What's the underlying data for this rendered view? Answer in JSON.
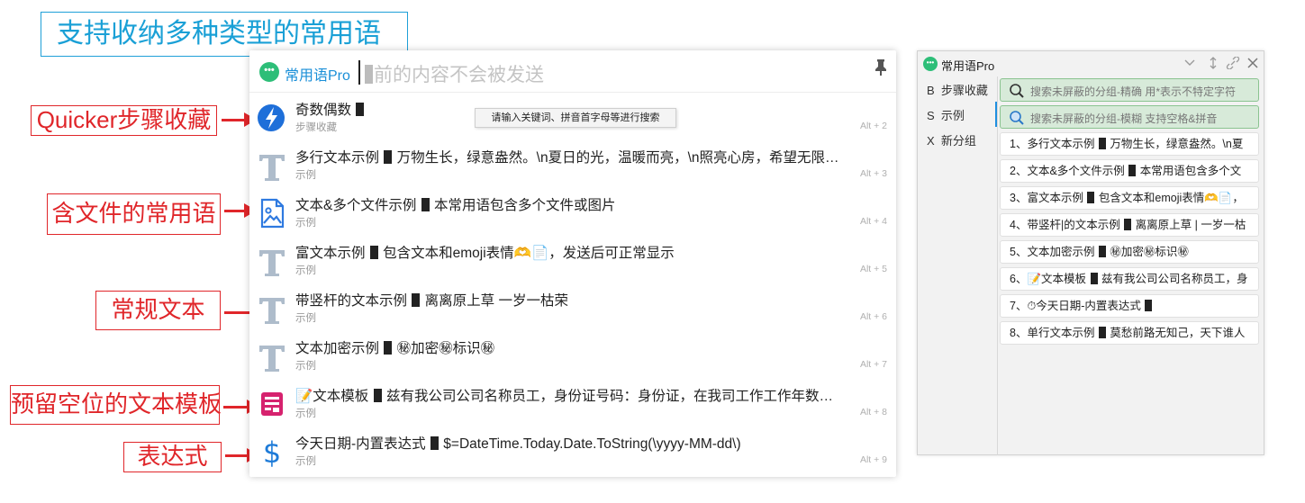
{
  "heading": "支持收纳多种类型的常用语",
  "callouts": {
    "quicker": "Quicker步骤收藏",
    "file": "含文件的常用语",
    "plain": "常规文本",
    "template": "预留空位的文本模板",
    "expression": "表达式"
  },
  "popup": {
    "app_name": "常用语Pro",
    "search_placeholder": "前的内容不会被发送",
    "tooltip": "请输入关键词、拼音首字母等进行搜索",
    "items": [
      {
        "title_pre": "奇数偶数",
        "title_post": "",
        "sub": "步骤收藏",
        "key": "Alt + 2",
        "icon": "quicker-bolt-icon"
      },
      {
        "title_pre": "多行文本示例",
        "title_post": "万物生长，绿意盎然。\\n夏日的光，温暖而亮，\\n照亮心房，希望无限。\\n...",
        "sub": "示例",
        "key": "Alt + 3",
        "icon": "text-t-icon"
      },
      {
        "title_pre": "文本&多个文件示例",
        "title_post": "本常用语包含多个文件或图片",
        "sub": "示例",
        "key": "Alt + 4",
        "icon": "image-file-icon"
      },
      {
        "title_pre": "富文本示例",
        "title_post": "包含文本和emoji表情🫶📄，发送后可正常显示",
        "sub": "示例",
        "key": "Alt + 5",
        "icon": "text-t-icon"
      },
      {
        "title_pre": "带竖杆的文本示例",
        "title_post": "离离原上草  一岁一枯荣",
        "sub": "示例",
        "key": "Alt + 6",
        "icon": "text-t-icon"
      },
      {
        "title_pre": "文本加密示例",
        "title_post": "㊙加密㊙标识㊙",
        "sub": "示例",
        "key": "Alt + 7",
        "icon": "text-t-icon"
      },
      {
        "title_pre": "📝文本模板",
        "title_post": "兹有我公司公司名称员工，身份证号码：身份证，在我司工作工作年数年，...",
        "sub": "示例",
        "key": "Alt + 8",
        "icon": "template-icon"
      },
      {
        "title_pre": "今天日期-内置表达式",
        "title_post": "$=DateTime.Today.Date.ToString(\\yyyy-MM-dd\\)",
        "sub": "示例",
        "key": "Alt + 9",
        "icon": "dollar-icon"
      }
    ]
  },
  "window": {
    "title": "常用语Pro",
    "groups": [
      {
        "key": "B",
        "label": "步骤收藏"
      },
      {
        "key": "S",
        "label": "示例"
      },
      {
        "key": "X",
        "label": "新分组"
      }
    ],
    "search_exact": "搜索未屏蔽的分组-精确  用*表示不特定字符",
    "search_fuzzy": "搜索未屏蔽的分组-模糊  支持空格&拼音",
    "items": [
      {
        "pre": "1、多行文本示例",
        "post": "万物生长，绿意盎然。\\n夏"
      },
      {
        "pre": "2、文本&多个文件示例",
        "post": "本常用语包含多个文"
      },
      {
        "pre": "3、富文本示例",
        "post": "包含文本和emoji表情🫶📄，"
      },
      {
        "pre": "4、带竖杆|的文本示例",
        "post": "离离原上草 | 一岁一枯"
      },
      {
        "pre": "5、文本加密示例",
        "post": "㊙加密㊙标识㊙"
      },
      {
        "pre": "6、📝文本模板",
        "post": "兹有我公司公司名称员工，身"
      },
      {
        "pre": "7、⏱今天日期-内置表达式",
        "post": ""
      },
      {
        "pre": "8、单行文本示例",
        "post": "莫愁前路无知己，天下谁人"
      }
    ]
  },
  "colors": {
    "accent": "#1a8fd8",
    "callout": "#e0262a",
    "brand_green": "#2dbe78"
  }
}
